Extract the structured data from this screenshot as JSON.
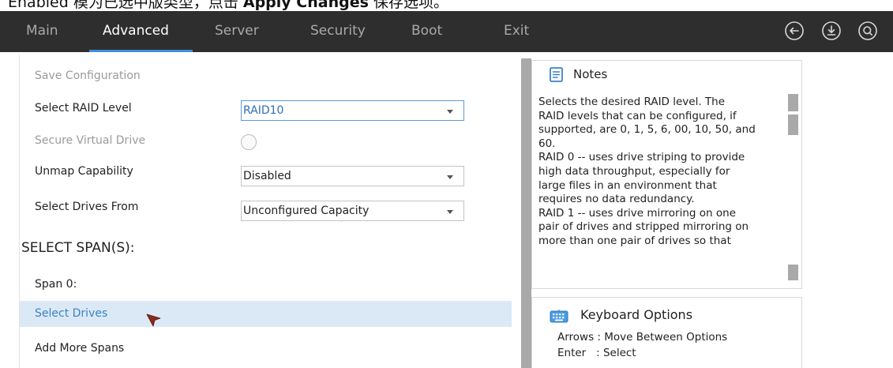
{
  "caption": {
    "prefix": "Enabled 模为已选中版类型，点击 ",
    "bold": "Apply Changes",
    "suffix": " 保存选项。"
  },
  "topbar": {
    "tabs": [
      {
        "label": "Main",
        "active": false
      },
      {
        "label": "Advanced",
        "active": true
      },
      {
        "label": "Server",
        "active": false
      },
      {
        "label": "Security",
        "active": false
      },
      {
        "label": "Boot",
        "active": false
      },
      {
        "label": "Exit",
        "active": false
      }
    ],
    "icons": [
      "back-circle-icon",
      "download-circle-icon",
      "search-circle-icon"
    ]
  },
  "form": {
    "save_configuration": "Save Configuration",
    "raid_level_label": "Select RAID Level",
    "raid_level_value": "RAID10",
    "secure_vd_label": "Secure Virtual Drive",
    "unmap_label": "Unmap Capability",
    "unmap_value": "Disabled",
    "drives_from_label": "Select Drives From",
    "drives_from_value": "Unconfigured Capacity",
    "select_spans_title": "SELECT SPAN(S):",
    "span0_label": "Span 0:",
    "select_drives_label": "Select Drives",
    "add_more_spans_label": "Add More Spans"
  },
  "notes": {
    "title": "Notes",
    "body": "Selects the desired RAID level. The\nRAID levels that can be configured, if\nsupported, are 0, 1, 5, 6, 00, 10, 50, and\n60.\nRAID 0 -- uses drive striping to provide\nhigh data throughput, especially for\nlarge files in an environment that\nrequires no data redundancy.\nRAID 1 -- uses drive mirroring on one\npair of drives and stripped mirroring on\nmore than one pair of drives so that"
  },
  "keyboard": {
    "title": "Keyboard Options",
    "lines": [
      "Arrows : Move Between Options",
      "Enter   : Select"
    ]
  },
  "colors": {
    "topbar_bg": "#2e2e2e",
    "accent": "#3d8fd8",
    "highlight_row": "#dbe9f7",
    "link_text": "#3b82c4"
  }
}
